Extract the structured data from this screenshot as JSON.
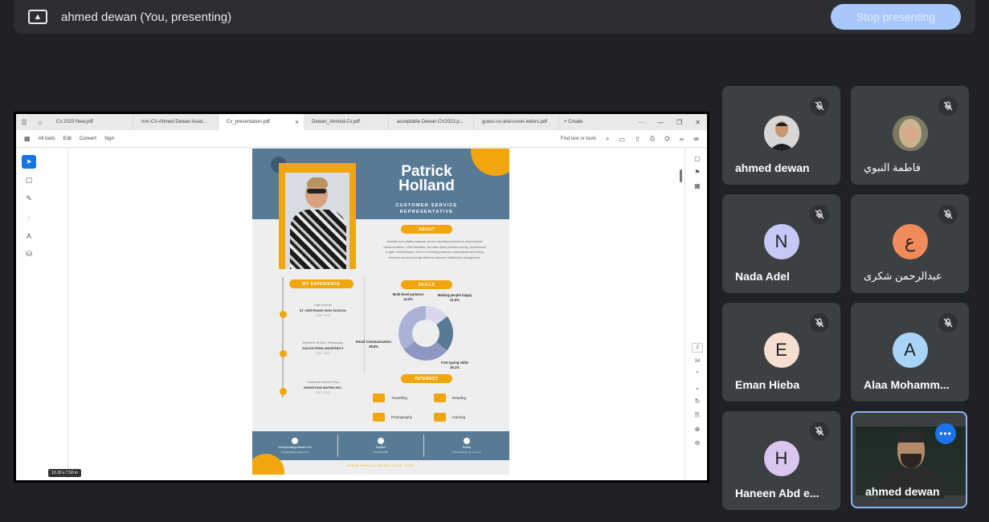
{
  "presenting_bar": {
    "presenter_label": "ahmed dewan (You, presenting)",
    "stop_button": "Stop presenting"
  },
  "shared_screen": {
    "tabs": [
      "Cv 2023 New.pdf",
      "non CV-Ahmed Dewan Acad...",
      "Cv_presentation.pdf",
      "Dewan_Ahmed-Cv.pdf",
      "acceptable Dewan CV2023.p...",
      "guess-cv-and-cover-letters.pdf"
    ],
    "active_tab_index": 2,
    "create_label": "+ Create",
    "toolbar": {
      "all_tools": "All tools",
      "edit": "Edit",
      "convert": "Convert",
      "sign": "Sign",
      "find": "Find text or tools"
    },
    "page_indicator": [
      "2",
      "34"
    ],
    "page_size_badge": "13.33 x 7.50 in",
    "cv": {
      "name": "Patrick Holland",
      "role": "CUSTOMER SERVICE REPRESENTATIVE",
      "about_heading": "ABOUT",
      "about_text": "Versatile and reliable customer service specialist proficient in multi-channel communications, CRM utilization, and data-driven problem-solving. Experienced in agile methodologies, keen in exceeding customer expectations and driving business success through effective customer relationship management.",
      "skills_heading": "SKILLS",
      "skills": [
        {
          "label": "Multi-level patience",
          "value": "14.3%"
        },
        {
          "label": "Making people happy",
          "value": "21.6%"
        },
        {
          "label": "Email Communication",
          "value": "28.8%"
        },
        {
          "label": "Fast typing skills",
          "value": "35.1%"
        }
      ],
      "experience_heading": "MY EXPERIENCE",
      "experience": [
        {
          "title": "High School",
          "place": "ST. GERTRUDE HIGH SCHOOL",
          "years": "2006 - 2010"
        },
        {
          "title": "Bachelor of Arts, Philosophy",
          "place": "DAVOS PENN UNIVERSITY",
          "years": "2010 - 2017"
        },
        {
          "title": "Customer Service Rep",
          "place": "SHIPATHON MATRIX INC.",
          "years": "2017 - 2021"
        }
      ],
      "interest_heading": "INTEREST",
      "interests": [
        "Travelling",
        "Reading",
        "Photography",
        "Gaming"
      ],
      "footer": [
        {
          "label": "hello@reallygreatsite.com",
          "value": "hello@reallygreatsite.com"
        },
        {
          "label": "English",
          "value": "123-456-7890"
        },
        {
          "label": "Reddy",
          "value": "123 Anywhere St., Any City"
        }
      ],
      "website": "WWW.REALLYGREATSITE.COM"
    }
  },
  "participants": [
    {
      "name": "ahmed dewan",
      "type": "photo",
      "muted": true
    },
    {
      "name": "فاطمة النبوي",
      "type": "photo",
      "muted": true,
      "rtl": true
    },
    {
      "name": "Nada Adel",
      "initial": "N",
      "color": "#c6c8f5",
      "muted": true
    },
    {
      "name": "عبدالرحمن شكرى",
      "initial": "ع",
      "color": "#f28b5c",
      "muted": true,
      "rtl": true
    },
    {
      "name": "Eman Hieba",
      "initial": "E",
      "color": "#f6ded0",
      "muted": true
    },
    {
      "name": "Alaa Mohamm...",
      "initial": "A",
      "color": "#a8d4f8",
      "muted": true
    },
    {
      "name": "Haneen Abd e...",
      "initial": "H",
      "color": "#dbc6f0",
      "muted": true
    },
    {
      "name": "ahmed dewan",
      "type": "video",
      "muted": false
    }
  ],
  "icons": {
    "mic_off": "mic-off-icon",
    "more": "more-options-icon",
    "present": "present-screen-icon"
  }
}
